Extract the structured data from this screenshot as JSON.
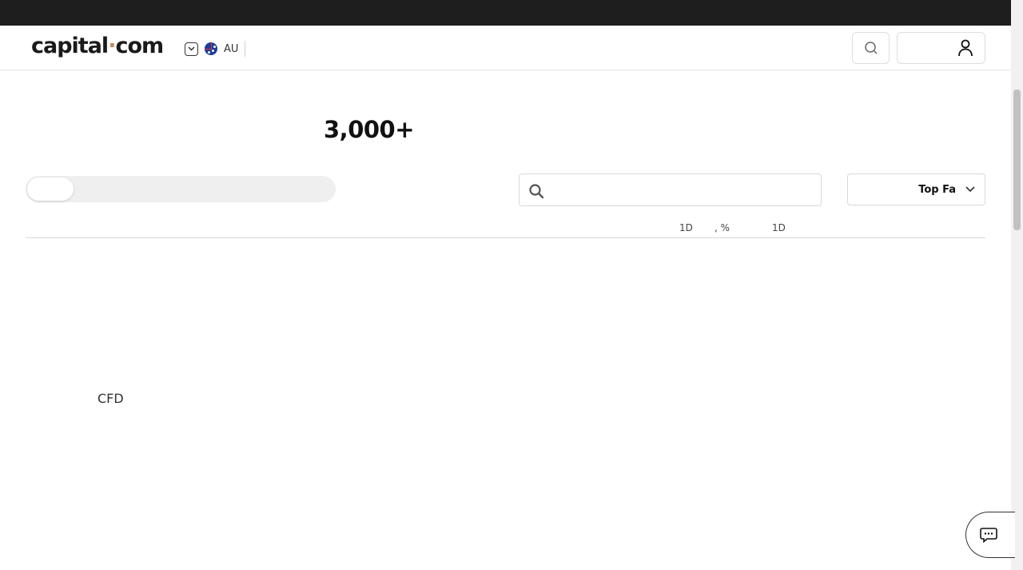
{
  "logo": {
    "text_main": "capital",
    "text_dot": "·",
    "text_tail": "com"
  },
  "region": {
    "code": "AU",
    "flag_icon": "australia-flag-icon"
  },
  "header": {
    "search_icon": "search-icon",
    "account_icon": "user-icon"
  },
  "hero": {
    "instrument_count": "3,000+"
  },
  "filters": {
    "search_placeholder": "",
    "sort_value": "Top Fa"
  },
  "table": {
    "columns": [
      "1D",
      ", %",
      "1D"
    ]
  },
  "content": {
    "cfd_label": "CFD"
  },
  "chat": {
    "icon": "chat-icon"
  },
  "colors": {
    "topbar": "#1e1e1e",
    "accent": "#c18b5c"
  }
}
